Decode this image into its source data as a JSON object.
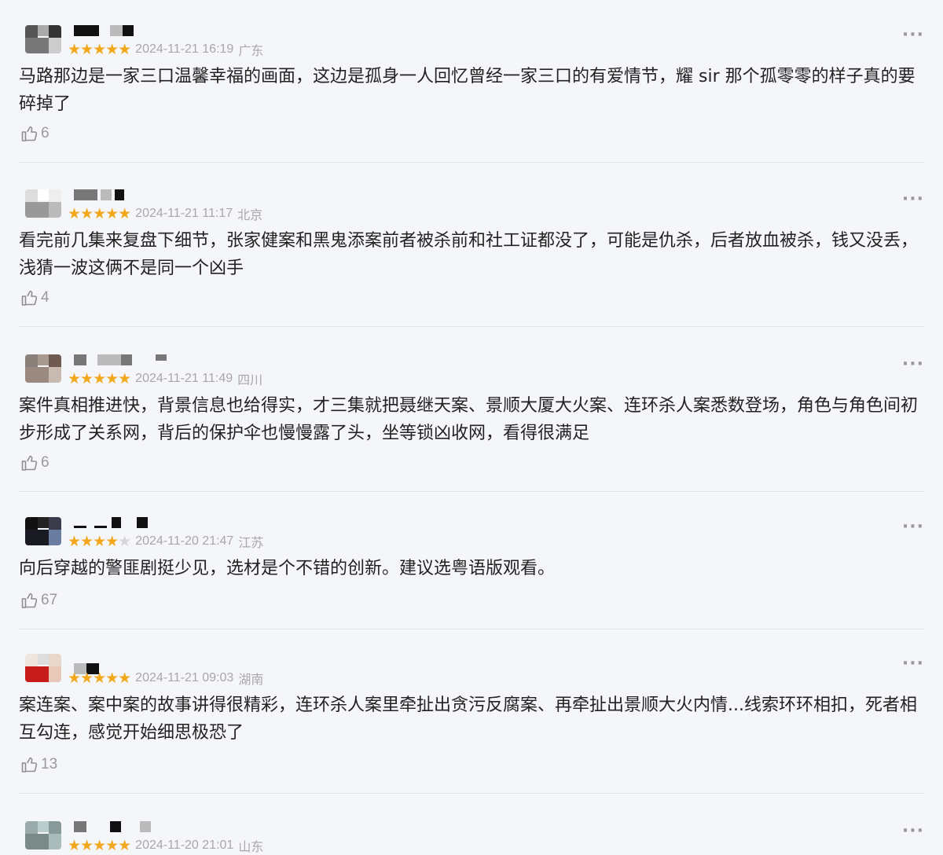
{
  "comments": [
    {
      "stars": "★★★★★",
      "stars_off": "",
      "date": "2024-11-21 16:19",
      "location": "广东",
      "text": "马路那边是一家三口温馨幸福的画面，这边是孤身一人回忆曾经一家三口的有爱情节，耀 sir 那个孤零零的样子真的要碎掉了",
      "likes": "6"
    },
    {
      "stars": "★★★★★",
      "stars_off": "",
      "date": "2024-11-21 11:17",
      "location": "北京",
      "text": "看完前几集来复盘下细节，张家健案和黑鬼添案前者被杀前和社工证都没了，可能是仇杀，后者放血被杀，钱又没丢，浅猜一波这俩不是同一个凶手",
      "likes": "4"
    },
    {
      "stars": "★★★★★",
      "stars_off": "",
      "date": "2024-11-21 11:49",
      "location": "四川",
      "text": "案件真相推进快，背景信息也给得实，才三集就把聂继天案、景顺大厦大火案、连环杀人案悉数登场，角色与角色间初步形成了关系网，背后的保护伞也慢慢露了头，坐等锁凶收网，看得很满足",
      "likes": "6"
    },
    {
      "stars": "★★★★",
      "stars_off": "★",
      "date": "2024-11-20 21:47",
      "location": "江苏",
      "text": "向后穿越的警匪剧挺少见，选材是个不错的创新。建议选粤语版观看。",
      "likes": "67"
    },
    {
      "stars": "★★★★★",
      "stars_off": "",
      "date": "2024-11-21 09:03",
      "location": "湖南",
      "text": "案连案、案中案的故事讲得很精彩，连环杀人案里牵扯出贪污反腐案、再牵扯出景顺大火内情...线索环环相扣，死者相互勾连，感觉开始细思极恐了",
      "likes": "13"
    },
    {
      "stars": "★★★★★",
      "stars_off": "",
      "date": "2024-11-20 21:01",
      "location": "山东",
      "text": "",
      "likes": ""
    }
  ],
  "icons": {
    "more": "more-dots-icon",
    "like": "thumbs-up-icon",
    "star": "star-icon"
  },
  "colors": {
    "background": "#f5f6fa",
    "star": "#f2a81d",
    "meta": "#a8a8a8"
  }
}
